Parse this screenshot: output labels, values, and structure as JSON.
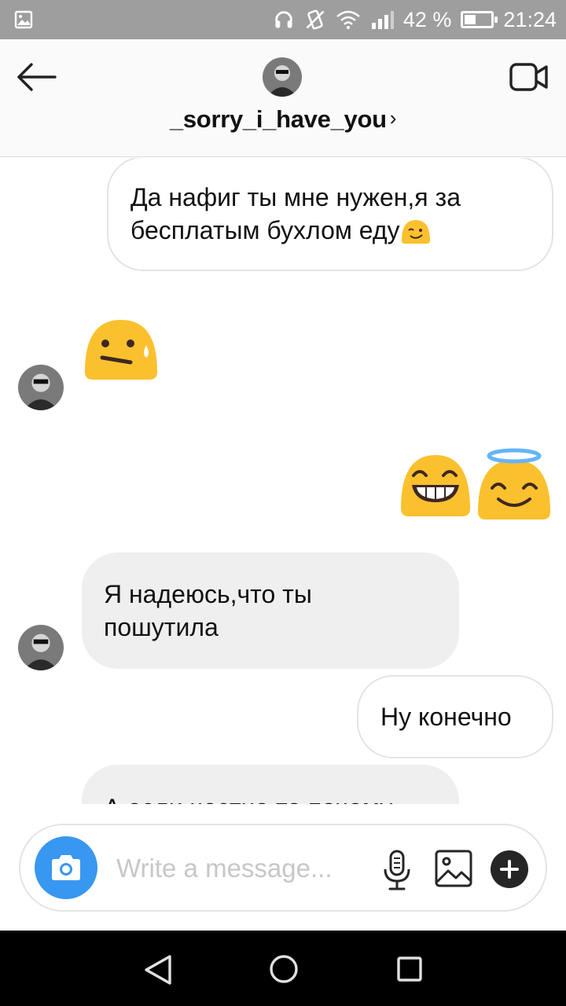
{
  "status_bar": {
    "battery_text": "42 %",
    "battery_level": 0.42,
    "time": "21:24",
    "icons": [
      "gallery-notification-icon",
      "headphones-icon",
      "vibrate-icon",
      "wifi-icon",
      "signal-icon",
      "battery-icon"
    ]
  },
  "header": {
    "username": "_sorry_i_have_you",
    "chevron": "›",
    "icons": [
      "back-arrow-icon",
      "video-call-icon"
    ]
  },
  "messages": [
    {
      "direction": "outgoing",
      "text": "Да нафиг ты мне нужен,я за\nбесплатым бухлом еду",
      "emoji": "winking-face"
    },
    {
      "direction": "incoming",
      "emoji": "downcast-face-with-sweat"
    },
    {
      "direction": "outgoing",
      "emoji": [
        "grinning-face-with-smiling-eyes",
        "smiling-face-with-halo"
      ]
    },
    {
      "direction": "incoming",
      "text": "Я надеюсь,что ты\nпошутила"
    },
    {
      "direction": "outgoing",
      "text": "Ну конечно"
    },
    {
      "direction": "incoming",
      "text": "А если честно то почему",
      "partially_visible": true
    }
  ],
  "composer": {
    "placeholder": "Write a message...",
    "value": "",
    "icons": [
      "camera-icon",
      "microphone-icon",
      "gallery-icon",
      "plus-icon"
    ]
  },
  "nav_bar": {
    "icons": [
      "nav-back-icon",
      "nav-home-icon",
      "nav-recents-icon"
    ]
  },
  "colors": {
    "status_bar_bg": "#9e9e9e",
    "header_bg": "#fafafa",
    "incoming_bubble": "#efefef",
    "outgoing_border": "#e4e4e4",
    "camera_button": "#3897f0",
    "emoji_yellow": "#fbc02d",
    "halo_blue": "#64b5f6",
    "navbar_bg": "#000000"
  }
}
